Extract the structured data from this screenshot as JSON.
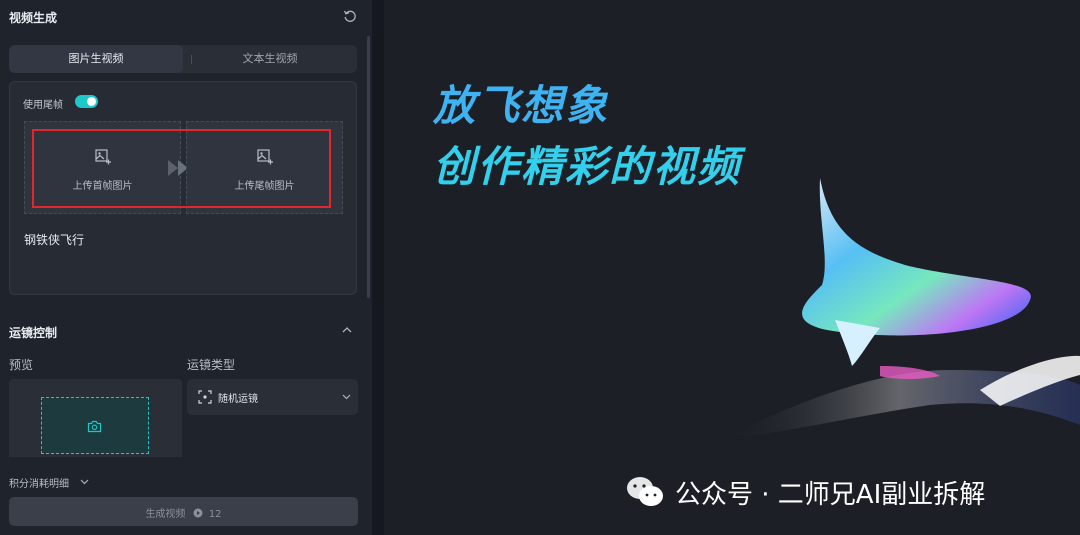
{
  "panel": {
    "title": "视频生成",
    "tabs": [
      "图片生视频",
      "文本生视频"
    ],
    "tail_frame_label": "使用尾帧",
    "tail_frame_enabled": true,
    "upload_first_label": "上传首帧图片",
    "upload_last_label": "上传尾帧图片",
    "prompt": "钢铁侠飞行"
  },
  "camera": {
    "section_title": "运镜控制",
    "preview_label": "预览",
    "type_label": "运镜类型",
    "type_value": "随机运镜"
  },
  "footer": {
    "points_detail": "积分消耗明细",
    "generate_label": "生成视频",
    "generate_cost": "12"
  },
  "preview": {
    "headline_1": "放飞想象",
    "headline_2": "创作精彩的视频",
    "watermark": "公众号 · 二师兄AI副业拆解"
  },
  "colors": {
    "accent": "#1ec8c8",
    "highlight": "#e3262d",
    "headline": "#3fb3f2"
  }
}
